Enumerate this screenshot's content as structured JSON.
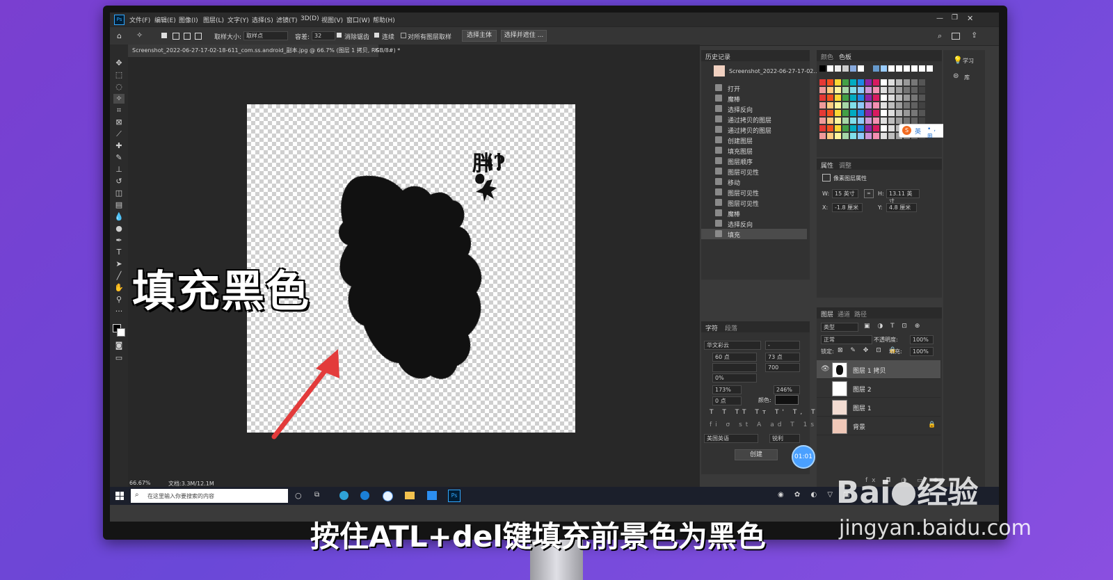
{
  "window": {
    "menu": [
      "文件(F)",
      "编辑(E)",
      "图像(I)",
      "图层(L)",
      "文字(Y)",
      "选择(S)",
      "滤镜(T)",
      "3D(D)",
      "视图(V)",
      "窗口(W)",
      "帮助(H)"
    ],
    "app_icon": "Ps"
  },
  "options_bar": {
    "sample_size_label": "取样大小:",
    "sample_size_value": "取样点",
    "tolerance_label": "容差:",
    "tolerance_value": "32",
    "antialias": "消除锯齿",
    "contiguous": "连续",
    "sample_all": "对所有图层取样",
    "select_subject": "选择主体",
    "select_mask": "选择并遮住 ..."
  },
  "document": {
    "tab_title": "Screenshot_2022-06-27-17-02-18-611_com.ss.android_副本.jpg @ 66.7% (图层 1 拷贝, RGB/8#) *",
    "zoom": "66.67%",
    "doc_size": "文档:3.3M/12.1M",
    "scribble_text": "胖?"
  },
  "history": {
    "title": "历史记录",
    "snapshot": "Screenshot_2022-06-27-17-02...",
    "items": [
      "打开",
      "魔棒",
      "选择反向",
      "通过拷贝的图层",
      "通过拷贝的图层",
      "创建图层",
      "填充图层",
      "图层顺序",
      "图层可见性",
      "移动",
      "图层可见性",
      "图层可见性",
      "魔棒",
      "选择反向",
      "填充"
    ],
    "active_index": 14
  },
  "color_panel": {
    "tabs": [
      "颜色",
      "色板"
    ]
  },
  "properties": {
    "tabs": [
      "属性",
      "调整"
    ],
    "subtitle": "像素图层属性",
    "w_label": "W:",
    "w": "15 英寸",
    "h_label": "H:",
    "h": "13.11 英寸",
    "x_label": "X:",
    "x": "-1.8 厘米",
    "y_label": "Y:",
    "y": "4.8 厘米"
  },
  "character": {
    "tabs": [
      "字符",
      "段落"
    ],
    "font": "华文彩云",
    "size": "60 点",
    "leading": "73 点",
    "kerning": "",
    "tracking": "700",
    "scale_v": "0%",
    "vert_scale": "173%",
    "horiz_scale": "246%",
    "baseline": "0 点",
    "color_label": "颜色:",
    "lang": "美国英语",
    "aa": "锐利",
    "create_btn": "创建"
  },
  "layers": {
    "tabs": [
      "图层",
      "通道",
      "路径"
    ],
    "filter": "类型",
    "blend": "正常",
    "opacity_label": "不透明度:",
    "opacity": "100%",
    "lock_label": "锁定:",
    "fill_label": "填充:",
    "fill": "100%",
    "items": [
      {
        "name": "图层 1 拷贝",
        "active": true
      },
      {
        "name": "图层 2",
        "active": false
      },
      {
        "name": "图层 1",
        "active": false
      },
      {
        "name": "背景",
        "active": false
      }
    ]
  },
  "learn": {
    "label": "学习",
    "lib": "库"
  },
  "taskbar": {
    "search_placeholder": "在这里输入你要搜索的内容",
    "app": "Ps"
  },
  "ime": {
    "label": "英"
  },
  "timer": "01:01",
  "overlay_title": "填充黑色",
  "caption": "按住ATL+del键填充前景色为黑色",
  "watermark": {
    "brand": "Bai",
    "brand2": "经验",
    "url": "jingyan.baidu.com"
  },
  "colors": {
    "accent": "#e33b3b",
    "ps_blue": "#31a8ff"
  }
}
